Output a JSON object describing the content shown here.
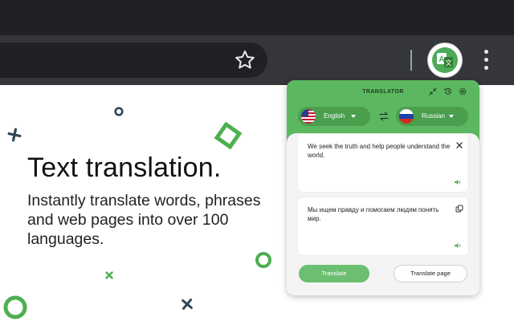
{
  "browser": {
    "toolbar_icons": [
      "star-icon",
      "translator-extension-icon",
      "menu-kebab-icon"
    ]
  },
  "marketing": {
    "headline": "Text translation.",
    "subtext": "Instantly translate words, phrases and web pages into over 100 languages."
  },
  "popup": {
    "title": "TRANSLATOR",
    "header_icons": [
      "collapse-icon",
      "history-icon",
      "settings-icon"
    ],
    "source_language": "English",
    "target_language": "Russian",
    "source_text": "We seek the truth and help people understand the world.",
    "translated_text": "Мы ищем правду и помогаем людям понять мир.",
    "translate_button": "Translate",
    "translate_page_button": "Translate page"
  },
  "colors": {
    "accent": "#5cb860",
    "accent_dark": "#4a9f4f",
    "chrome_dark": "#202124",
    "chrome_toolbar": "#35363a",
    "decoration_green": "#4caf50",
    "decoration_slate": "#2f4858"
  }
}
